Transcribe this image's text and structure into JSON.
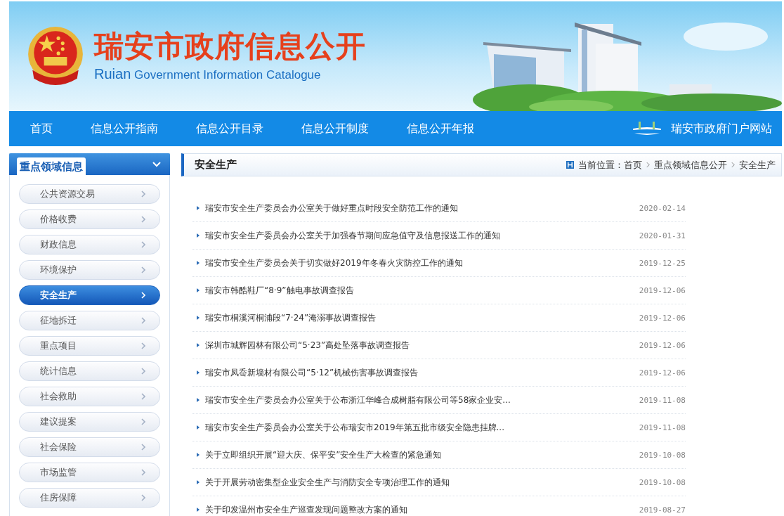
{
  "header": {
    "title": "瑞安市政府信息公开",
    "subtitle_lead": "Ruian",
    "subtitle": "Government Information Catalogue"
  },
  "nav": {
    "items": [
      "首页",
      "信息公开指南",
      "信息公开目录",
      "信息公开制度",
      "信息公开年报"
    ],
    "portal_link": "瑞安市政府门户网站"
  },
  "sidebar": {
    "title": "重点领域信息",
    "items": [
      {
        "label": "公共资源交易",
        "selected": false
      },
      {
        "label": "价格收费",
        "selected": false
      },
      {
        "label": "财政信息",
        "selected": false
      },
      {
        "label": "环境保护",
        "selected": false
      },
      {
        "label": "安全生产",
        "selected": true
      },
      {
        "label": "征地拆迁",
        "selected": false
      },
      {
        "label": "重点项目",
        "selected": false
      },
      {
        "label": "统计信息",
        "selected": false
      },
      {
        "label": "社会救助",
        "selected": false
      },
      {
        "label": "建议提案",
        "selected": false
      },
      {
        "label": "社会保险",
        "selected": false
      },
      {
        "label": "市场监管",
        "selected": false
      },
      {
        "label": "住房保障",
        "selected": false
      }
    ]
  },
  "main": {
    "title": "安全生产",
    "breadcrumb": {
      "label": "当前位置：",
      "items": [
        "首页",
        "重点领域信息公开",
        "安全生产"
      ]
    },
    "articles": [
      {
        "title": "瑞安市安全生产委员会办公室关于做好重点时段安全防范工作的通知",
        "date": "2020-02-14"
      },
      {
        "title": "瑞安市安全生产委员会办公室关于加强春节期间应急值守及信息报送工作的通知",
        "date": "2020-01-31"
      },
      {
        "title": "瑞安市安全生产委员会关于切实做好2019年冬春火灾防控工作的通知",
        "date": "2019-12-25"
      },
      {
        "title": "瑞安市韩酷鞋厂“8·9”触电事故调查报告",
        "date": "2019-12-06"
      },
      {
        "title": "瑞安市桐溪河桐浦段“7·24”淹溺事故调查报告",
        "date": "2019-12-06"
      },
      {
        "title": "深圳市城辉园林有限公司“5·23”高处坠落事故调查报告",
        "date": "2019-12-06"
      },
      {
        "title": "瑞安市凤岙新墙材有限公司“5·12”机械伤害事故调查报告",
        "date": "2019-12-06"
      },
      {
        "title": "瑞安市安全生产委员会办公室关于公布浙江华峰合成树脂有限公司等58家企业安...",
        "date": "2019-11-08"
      },
      {
        "title": "瑞安市安全生产委员会办公室关于公布瑞安市2019年第五批市级安全隐患挂牌...",
        "date": "2019-11-08"
      },
      {
        "title": "关于立即组织开展“迎大庆、保平安”安全生产大检查的紧急通知",
        "date": "2019-10-08"
      },
      {
        "title": "关于开展劳动密集型企业安全生产与消防安全专项治理工作的通知",
        "date": "2019-10-08"
      },
      {
        "title": "关于印发温州市安全生产巡查发现问题整改方案的通知",
        "date": "2019-08-27"
      }
    ]
  }
}
